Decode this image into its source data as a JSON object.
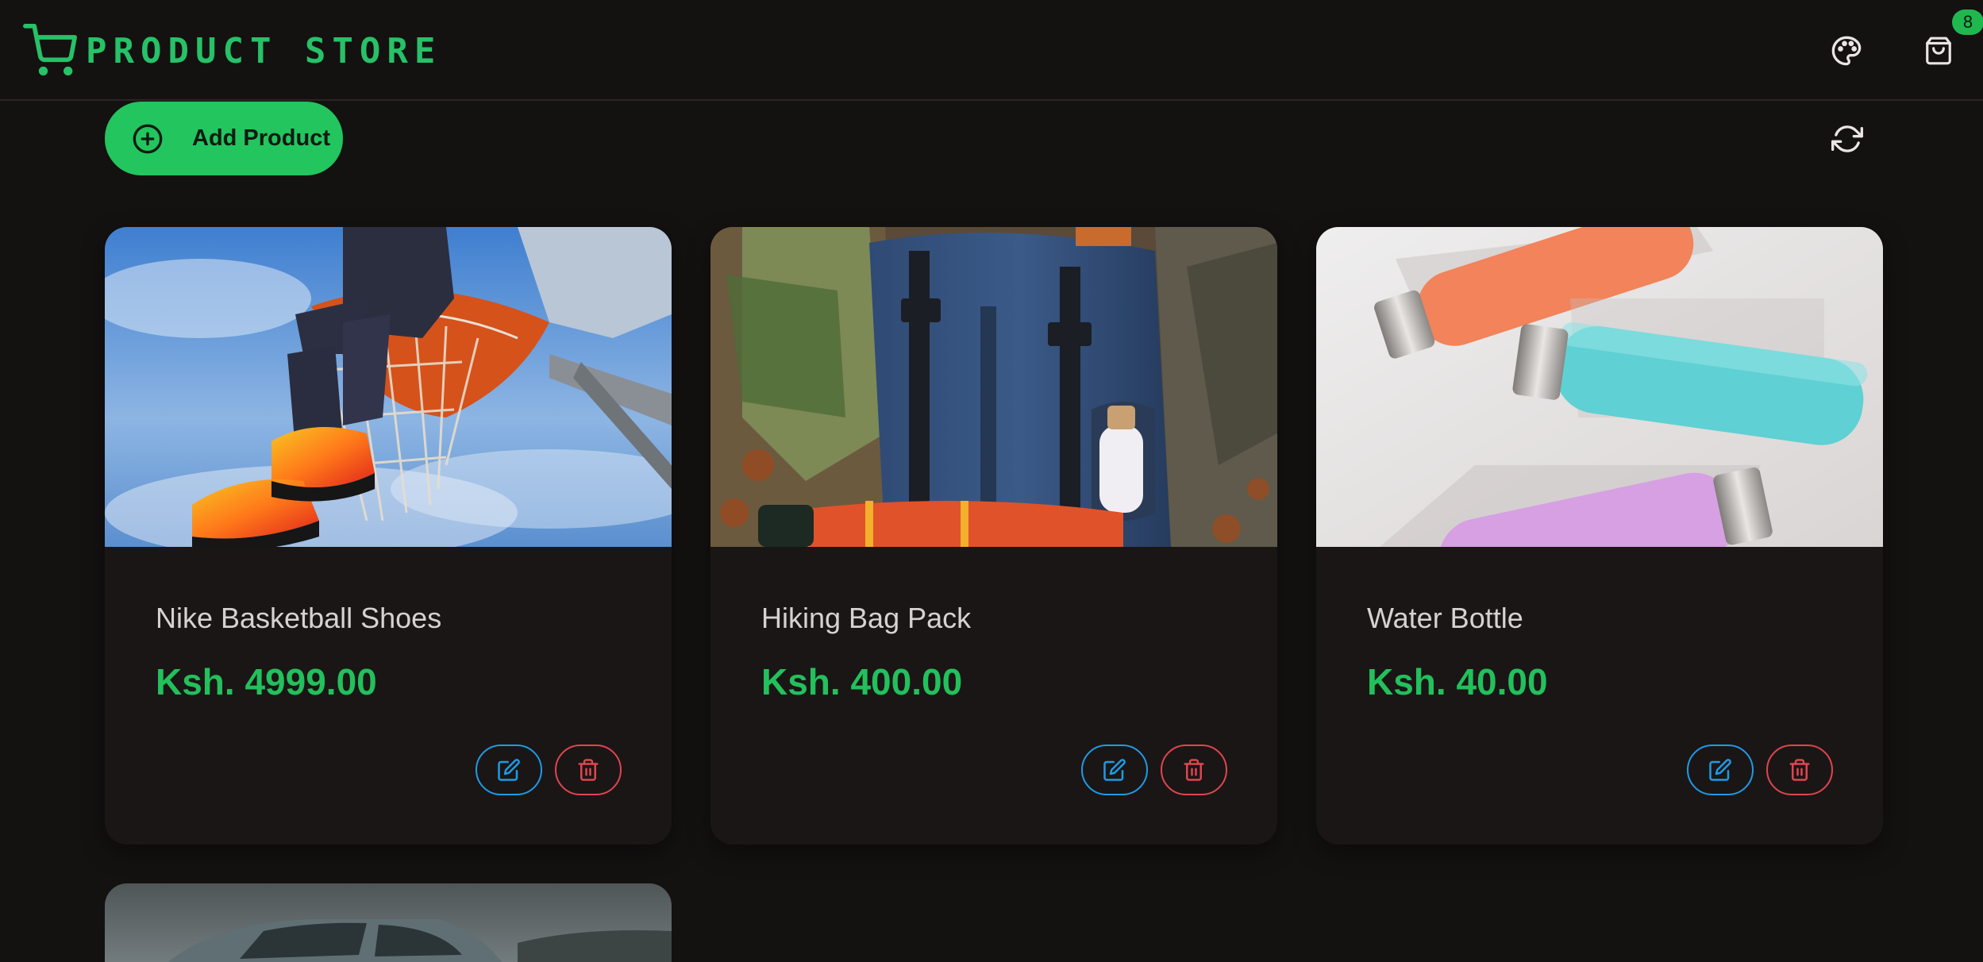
{
  "header": {
    "brand_text": "PRODUCT STORE",
    "cart_count": "8"
  },
  "toolbar": {
    "add_label": "Add Product"
  },
  "products": [
    {
      "name": "Nike Basketball Shoes",
      "price": "Ksh. 4999.00"
    },
    {
      "name": "Hiking Bag Pack",
      "price": "Ksh. 400.00"
    },
    {
      "name": "Water Bottle",
      "price": "Ksh. 40.00"
    }
  ],
  "colors": {
    "accent": "#22c55e",
    "background": "#141111",
    "card": "#1a1616",
    "edit": "#1e9be6",
    "delete": "#e0454f"
  },
  "icons": [
    "shopping-cart-icon",
    "palette-icon",
    "shopping-bag-icon",
    "plus-circle-icon",
    "refresh-icon",
    "edit-icon",
    "trash-icon"
  ]
}
